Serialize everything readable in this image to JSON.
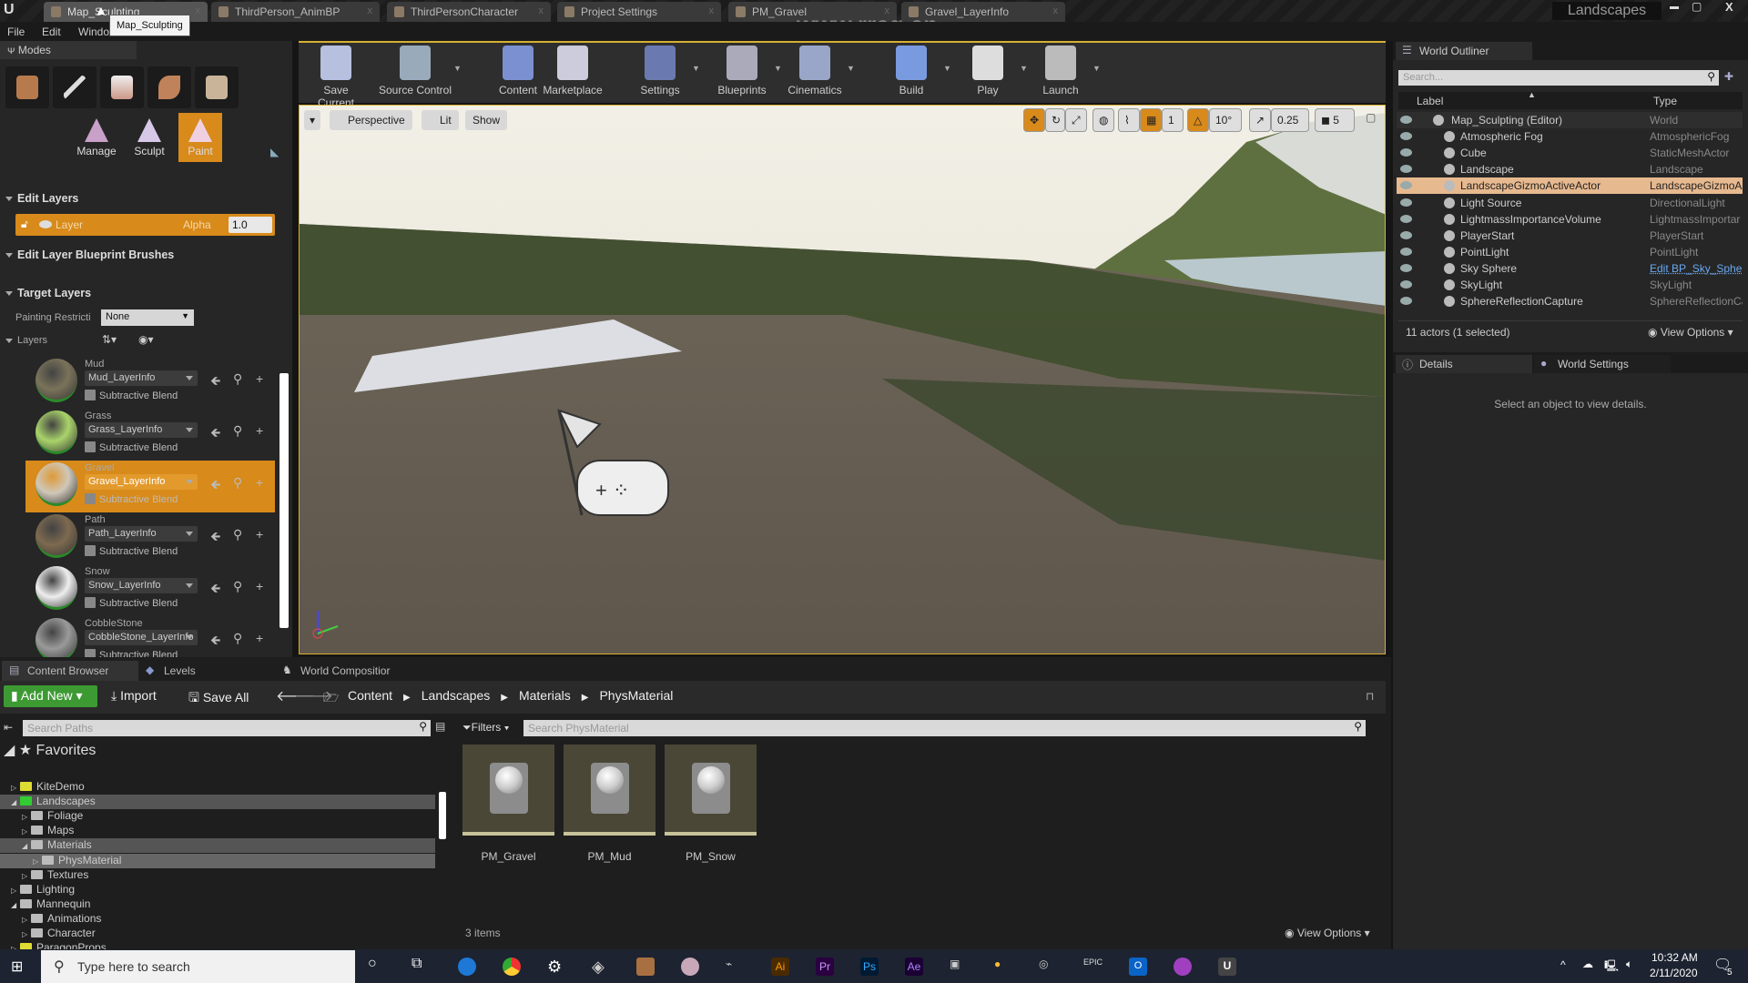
{
  "doc_tabs": [
    {
      "label": "Map_Sculpting",
      "active": true
    },
    {
      "label": "ThirdPerson_AnimBP"
    },
    {
      "label": "ThirdPersonCharacter"
    },
    {
      "label": "Project Settings"
    },
    {
      "label": "PM_Gravel"
    },
    {
      "label": "Gravel_LayerInfo"
    }
  ],
  "tooltip": "Map_Sculpting",
  "watermark": "www.rrcg.cn",
  "project_name": "Landscapes",
  "menu": [
    "File",
    "Edit",
    "Windo"
  ],
  "modes": {
    "tab": "Modes",
    "tools": [
      {
        "label": "Manage"
      },
      {
        "label": "Sculpt"
      },
      {
        "label": "Paint",
        "active": true
      }
    ],
    "edit_layers": "Edit Layers",
    "layer_row": {
      "name": "Layer",
      "alpha_label": "Alpha",
      "alpha_value": "1.0"
    },
    "blueprint_brushes": "Edit Layer Blueprint Brushes",
    "target_layers": "Target Layers",
    "painting_restriction": {
      "label": "Painting Restricti",
      "value": "None"
    },
    "layers_label": "Layers",
    "layers": [
      {
        "name": "Mud",
        "info": "Mud_LayerInfo",
        "sub": "Subtractive Blend",
        "color": "#7a735a"
      },
      {
        "name": "Grass",
        "info": "Grass_LayerInfo",
        "sub": "Subtractive Blend",
        "color": "#a9d36a"
      },
      {
        "name": "Gravel",
        "info": "Gravel_LayerInfo",
        "sub": "Subtractive Blend",
        "color": "#cfc7b8",
        "selected": true
      },
      {
        "name": "Path",
        "info": "Path_LayerInfo",
        "sub": "Subtractive Blend",
        "color": "#7d6a50"
      },
      {
        "name": "Snow",
        "info": "Snow_LayerInfo",
        "sub": "Subtractive Blend",
        "color": "#eeeeee"
      },
      {
        "name": "CobbleStone",
        "info": "CobbleStone_LayerInfo",
        "sub": "Subtractive Blend",
        "color": "#9a9a9a"
      }
    ]
  },
  "toolbar": [
    "Save Current",
    "Source Control",
    "Content",
    "Marketplace",
    "Settings",
    "Blueprints",
    "Cinematics",
    "Build",
    "Play",
    "Launch"
  ],
  "viewport": {
    "perspective": "Perspective",
    "lit": "Lit",
    "show": "Show",
    "grid_snap": "1",
    "rot_snap": "10°",
    "scale_snap": "0.25",
    "cam_speed": "5"
  },
  "outliner": {
    "tab": "World Outliner",
    "search_placeholder": "Search...",
    "col_label": "Label",
    "col_type": "Type",
    "rows": [
      {
        "label": "Map_Sculpting (Editor)",
        "type": "World"
      },
      {
        "label": "Atmospheric Fog",
        "type": "AtmosphericFog"
      },
      {
        "label": "Cube",
        "type": "StaticMeshActor"
      },
      {
        "label": "Landscape",
        "type": "Landscape"
      },
      {
        "label": "LandscapeGizmoActiveActor",
        "type": "LandscapeGizmoA",
        "selected": true
      },
      {
        "label": "Light Source",
        "type": "DirectionalLight"
      },
      {
        "label": "LightmassImportanceVolume",
        "type": "LightmassImportar"
      },
      {
        "label": "PlayerStart",
        "type": "PlayerStart"
      },
      {
        "label": "PointLight",
        "type": "PointLight"
      },
      {
        "label": "Sky Sphere",
        "type": "Edit BP_Sky_Sphe",
        "link": true
      },
      {
        "label": "SkyLight",
        "type": "SkyLight"
      },
      {
        "label": "SphereReflectionCapture",
        "type": "SphereReflectionCa"
      }
    ],
    "footer": "11 actors (1 selected)",
    "view_options": "View Options"
  },
  "details": {
    "tab": "Details",
    "world_settings_tab": "World Settings",
    "empty": "Select an object to view details."
  },
  "content_browser": {
    "tabs": [
      "Content Browser",
      "Levels",
      "World Compositior"
    ],
    "add_new": "Add New",
    "import": "Import",
    "save_all": "Save All",
    "breadcrumb": [
      "Content",
      "Landscapes",
      "Materials",
      "PhysMaterial"
    ],
    "search_paths": "Search Paths",
    "filters": "Filters",
    "search_assets": "Search PhysMaterial",
    "favorites": "Favorites",
    "tree": [
      {
        "label": "KiteDemo",
        "depth": 1
      },
      {
        "label": "Landscapes",
        "depth": 1,
        "expanded": true,
        "sel": true
      },
      {
        "label": "Foliage",
        "depth": 2
      },
      {
        "label": "Maps",
        "depth": 2
      },
      {
        "label": "Materials",
        "depth": 2,
        "expanded": true,
        "sel": true
      },
      {
        "label": "PhysMaterial",
        "depth": 3,
        "sel": true
      },
      {
        "label": "Textures",
        "depth": 2
      },
      {
        "label": "Lighting",
        "depth": 1
      },
      {
        "label": "Mannequin",
        "depth": 1,
        "expanded": true
      },
      {
        "label": "Animations",
        "depth": 2
      },
      {
        "label": "Character",
        "depth": 2
      },
      {
        "label": "ParagonProps",
        "depth": 1
      }
    ],
    "assets": [
      "PM_Gravel",
      "PM_Mud",
      "PM_Snow"
    ],
    "count": "3 items",
    "view_options": "View Options"
  },
  "taskbar": {
    "search": "Type here to search",
    "time": "10:32 AM",
    "date": "2/11/2020",
    "notifications": "5"
  },
  "colors": {
    "accent": "#d88a1a",
    "add_new": "#3d9a33",
    "selection": "#e7b98f"
  }
}
